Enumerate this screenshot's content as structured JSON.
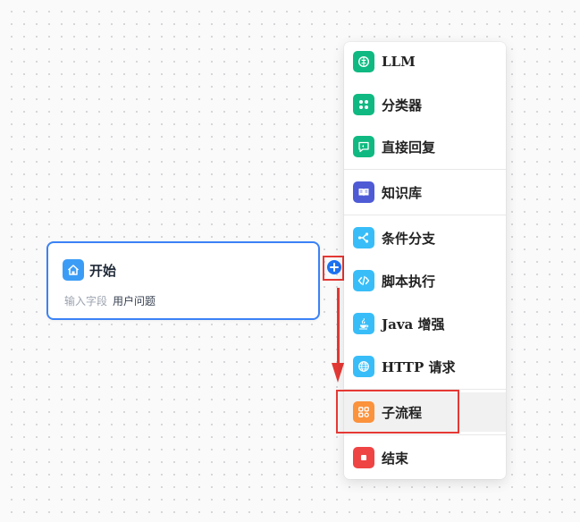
{
  "start_node": {
    "title": "开始",
    "field_label": "输入字段",
    "field_value": "用户问题",
    "icon": "home-icon",
    "color": "#3b9cf6"
  },
  "menu": {
    "items": [
      {
        "label": "LLM",
        "icon": "brain-icon",
        "color": "#10b981"
      },
      {
        "label": "分类器",
        "icon": "grid-icon",
        "color": "#10b981"
      },
      {
        "label": "直接回复",
        "icon": "reply-icon",
        "color": "#10b981"
      },
      {
        "label": "知识库",
        "icon": "book-icon",
        "color": "#4f5bd5"
      },
      {
        "label": "条件分支",
        "icon": "branch-icon",
        "color": "#38bdf8"
      },
      {
        "label": "脚本执行",
        "icon": "code-icon",
        "color": "#38bdf8"
      },
      {
        "label": "Java 增强",
        "icon": "java-icon",
        "color": "#38bdf8"
      },
      {
        "label": "HTTP 请求",
        "icon": "globe-icon",
        "color": "#38bdf8"
      },
      {
        "label": "子流程",
        "icon": "subflow-icon",
        "color": "#fb923c"
      },
      {
        "label": "结束",
        "icon": "stop-icon",
        "color": "#ef4444"
      }
    ]
  },
  "colors": {
    "accent": "#1d72f2",
    "highlight": "#e53935"
  }
}
